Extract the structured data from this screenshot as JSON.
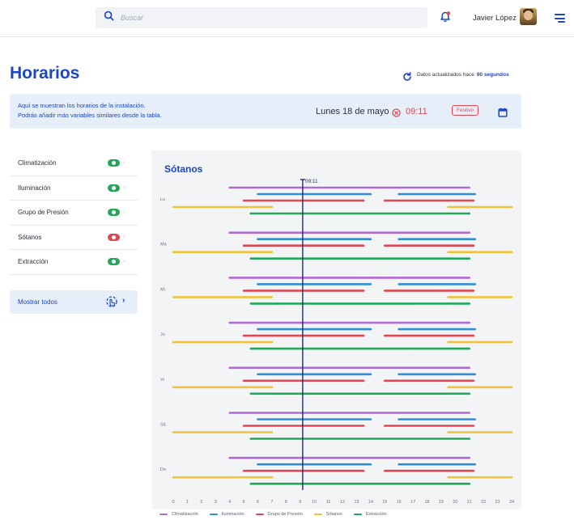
{
  "header": {
    "search_placeholder": "Buscar",
    "user_name": "Javier López"
  },
  "page": {
    "title": "Horarios",
    "updated_prefix": "Datos actualizados hace",
    "updated_value": "90 segundos"
  },
  "banner": {
    "line1": "Aquí se muestran los horarios de la instalación.",
    "line2": "Podrás añadir más variables similares desde la tabla.",
    "day_name": "Lunes",
    "day_date": "18 de mayo",
    "time": "09:11",
    "holiday_badge": "Festivo"
  },
  "sidebar": {
    "items": [
      {
        "label": "Climatización",
        "status": "on"
      },
      {
        "label": "Iluminación",
        "status": "on"
      },
      {
        "label": "Grupo de Presión",
        "status": "on"
      },
      {
        "label": "Sótanos",
        "status": "off"
      },
      {
        "label": "Extracción",
        "status": "on"
      }
    ],
    "show_all": "Mostrar todos"
  },
  "colors": {
    "accent": "#1a47c6",
    "on": "#23a65a",
    "off": "#e04752"
  },
  "chart_data": {
    "type": "timeline",
    "title": "Sótanos",
    "current_time_label": "09:11",
    "current_time": 9.18,
    "xlim": [
      0,
      24
    ],
    "x_ticks": [
      "0",
      "1",
      "2",
      "3",
      "4",
      "5",
      "6",
      "7",
      "8",
      "9",
      "10",
      "11",
      "12",
      "13",
      "14",
      "15",
      "16",
      "17",
      "18",
      "19",
      "20",
      "21",
      "22",
      "23",
      "24"
    ],
    "days": [
      "Lu",
      "Ma",
      "Mi",
      "Ju",
      "Vi",
      "Sá",
      "Do"
    ],
    "series": [
      {
        "name": "Climatización",
        "color": "#b06ad6",
        "segments": [
          [
            4,
            21
          ]
        ]
      },
      {
        "name": "Iluminación",
        "color": "#2e8fd6",
        "segments": [
          [
            6,
            14
          ],
          [
            16,
            21.4
          ]
        ]
      },
      {
        "name": "Grupo de Presión",
        "color": "#e04752",
        "segments": [
          [
            5,
            13.5
          ],
          [
            15,
            21.3
          ]
        ]
      },
      {
        "name": "Sótanos",
        "color": "#f0c23b",
        "segments": [
          [
            0,
            7
          ],
          [
            19.5,
            24
          ]
        ]
      },
      {
        "name": "Extracción",
        "color": "#23a65a",
        "segments": [
          [
            5.5,
            21
          ]
        ]
      }
    ]
  }
}
